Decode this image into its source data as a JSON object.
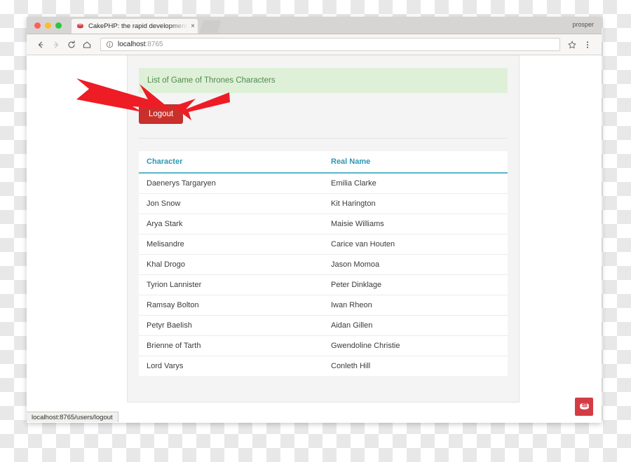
{
  "browser": {
    "tab": {
      "title": "CakePHP: the rapid development php framework",
      "favicon": "cakephp-icon",
      "close_label": "×"
    },
    "new_tab_label": "new-tab",
    "profile_name": "prosper",
    "toolbar": {
      "back_label": "back-arrow-icon",
      "forward_label": "forward-arrow-icon",
      "reload_label": "reload-icon",
      "home_label": "home-icon",
      "bookmark_label": "star-icon",
      "menu_label": "three-dot-menu-icon"
    },
    "omnibox": {
      "info_icon": "info-circle-icon",
      "host": "localhost",
      "port": ":8765",
      "full_url": "localhost:8765"
    },
    "status_bar": {
      "link_target": "localhost:8765/users/logout"
    }
  },
  "page": {
    "flash_message": "List of Game of Thrones Characters",
    "logout_button": "Logout",
    "badge": "cakephp-logo",
    "table": {
      "columns": [
        "Character",
        "Real Name"
      ],
      "rows": [
        [
          "Daenerys Targaryen",
          "Emilia Clarke"
        ],
        [
          "Jon Snow",
          "Kit Harington"
        ],
        [
          "Arya Stark",
          "Maisie Williams"
        ],
        [
          "Melisandre",
          "Carice van Houten"
        ],
        [
          "Khal Drogo",
          "Jason Momoa"
        ],
        [
          "Tyrion Lannister",
          "Peter Dinklage"
        ],
        [
          "Ramsay Bolton",
          "Iwan Rheon"
        ],
        [
          "Petyr Baelish",
          "Aidan Gillen"
        ],
        [
          "Brienne of Tarth",
          "Gwendoline Christie"
        ],
        [
          "Lord Varys",
          "Conleth Hill"
        ]
      ]
    }
  },
  "annotations": {
    "arrows": [
      {
        "name": "arrow-pointing-at-logout-from-left"
      },
      {
        "name": "arrow-pointing-at-logout-from-right"
      }
    ]
  },
  "colors": {
    "flash_background": "#dff0d8",
    "flash_text": "#4f8a4f",
    "logout_red": "#c9302c",
    "table_header_teal": "#2b99b2",
    "badge_red": "#d33c44",
    "annotation_red": "#ee1c25"
  }
}
